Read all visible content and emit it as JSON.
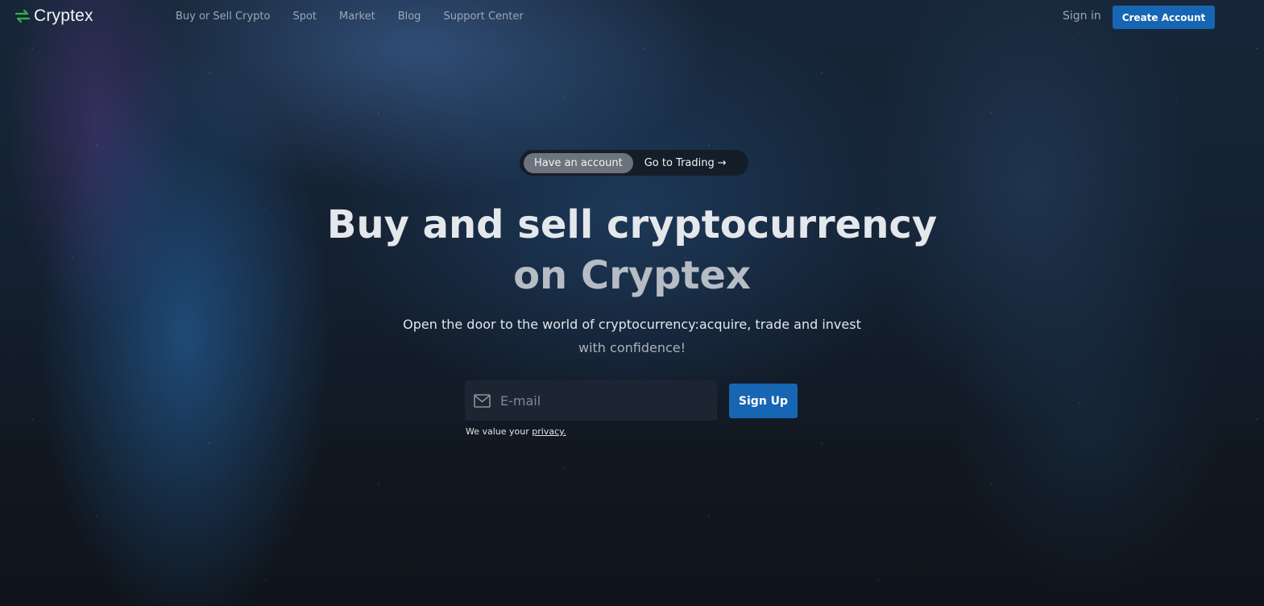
{
  "brand": {
    "name": "Cryptex",
    "accent": "#2fb54a"
  },
  "nav": {
    "items": [
      {
        "label": "Buy or Sell Crypto"
      },
      {
        "label": "Spot"
      },
      {
        "label": "Market"
      },
      {
        "label": "Blog"
      },
      {
        "label": "Support Center"
      }
    ],
    "signin_label": "Sign in",
    "create_account_label": "Create Account"
  },
  "hero": {
    "pill_left": "Have an account",
    "pill_right": "Go to Trading",
    "pill_arrow": "→",
    "title_line1": "Buy and sell cryptocurrency",
    "title_line2": "on Cryptex",
    "subtitle_line1": "Open the door to the world of cryptocurrency:acquire, trade and invest",
    "subtitle_line2": "with confidence!",
    "email_placeholder": "E-mail",
    "email_value": "",
    "signup_label": "Sign Up",
    "privacy_prefix": "We value your ",
    "privacy_link": "privacy."
  },
  "colors": {
    "primary_button": "#1766b3",
    "background": "#10151d",
    "input_bg": "#1c2531"
  },
  "icons": {
    "logo": "cryptex-logo-icon",
    "email": "mail-icon",
    "arrow": "arrow-right-icon"
  }
}
